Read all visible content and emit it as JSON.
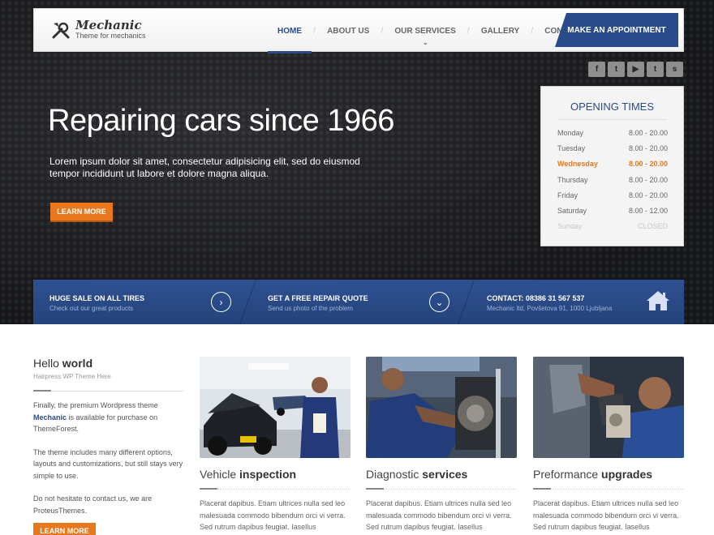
{
  "header": {
    "logo_title": "Mechanic",
    "logo_subtitle": "Theme for mechanics",
    "nav": [
      {
        "label": "HOME"
      },
      {
        "label": "ABOUT US"
      },
      {
        "label": "OUR SERVICES"
      },
      {
        "label": "GALLERY"
      },
      {
        "label": "CONTACT US"
      }
    ],
    "appointment_label": "MAKE AN APPOINTMENT"
  },
  "social": [
    "f",
    "t",
    "▶",
    "t",
    "s"
  ],
  "hero": {
    "title": "Repairing cars since 1966",
    "text": "Lorem ipsum dolor sit amet, consectetur adipisicing elit, sed do eiusmod tempor incididunt ut labore et dolore magna aliqua.",
    "button": "LEARN MORE"
  },
  "hours": {
    "title": "OPENING TIMES",
    "rows": [
      {
        "day": "Monday",
        "time": "8.00 - 20.00"
      },
      {
        "day": "Tuesday",
        "time": "8.00 - 20.00"
      },
      {
        "day": "Wednesday",
        "time": "8.00 - 20.00"
      },
      {
        "day": "Thursday",
        "time": "8.00 - 20.00"
      },
      {
        "day": "Friday",
        "time": "8.00 - 20.00"
      },
      {
        "day": "Saturday",
        "time": "8.00 - 12.00"
      },
      {
        "day": "Sunday",
        "time": "CLOSED"
      }
    ]
  },
  "infobar": {
    "sale_title": "HUGE SALE ON ALL TIRES",
    "sale_sub": "Check out our great products",
    "quote_title": "GET A FREE REPAIR QUOTE",
    "quote_sub": "Send us photo of the problem",
    "contact_title": "CONTACT: 08386 31 567 537",
    "contact_sub": "Mechanic ltd, Povšetova 91, 1000 Ljubljana"
  },
  "sidebar": {
    "title_light": "Hello",
    "title_bold": "world",
    "subtitle": "Hairpress WP Theme Here",
    "p1_before": "Finally, the premium Wordpress theme",
    "p1_brand": "Mechanic",
    "p1_after": "is available for purchase on ThemeForest.",
    "p2": "The theme includes many different options, layouts and customizations, but still stays very simple to use.",
    "p3": "Do not hesitate to contact us, we are ProteusThemes.",
    "button": "LEARN MORE"
  },
  "cards": [
    {
      "title_light": "Vehicle",
      "title_bold": "inspection",
      "text": "Placerat dapibus. Etiam ultrices nulla sed leo malesuada commodo bibendum orci vi verra. Sed rutrum dapibus feugiat. Iasellus"
    },
    {
      "title_light": "Diagnostic",
      "title_bold": "services",
      "text": "Placerat dapibus. Etiam ultrices nulla sed leo malesuada commodo bibendum orci vi verra. Sed rutrum dapibus feugiat. Iasellus"
    },
    {
      "title_light": "Preformance",
      "title_bold": "upgrades",
      "text": "Placerat dapibus. Etiam ultrices nulla sed leo malesuada commodo bibendum orci vi verra. Sed rutrum dapibus feugiat. Iasellus"
    }
  ],
  "colors": {
    "brand_blue": "#2a4b8a",
    "accent_orange": "#e8781e"
  }
}
